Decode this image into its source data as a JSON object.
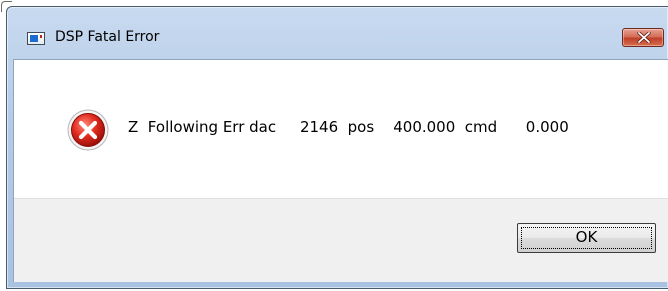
{
  "window": {
    "title": "DSP Fatal Error"
  },
  "titlebar": {
    "app_icon": "application-icon",
    "close_icon": "close-icon",
    "close_button_color": "#c0402a"
  },
  "message": {
    "icon": "error-icon",
    "icon_color": "#d42020",
    "text": "Z  Following Err dac     2146  pos    400.000  cmd      0.000"
  },
  "buttons": {
    "ok_label": "OK"
  }
}
